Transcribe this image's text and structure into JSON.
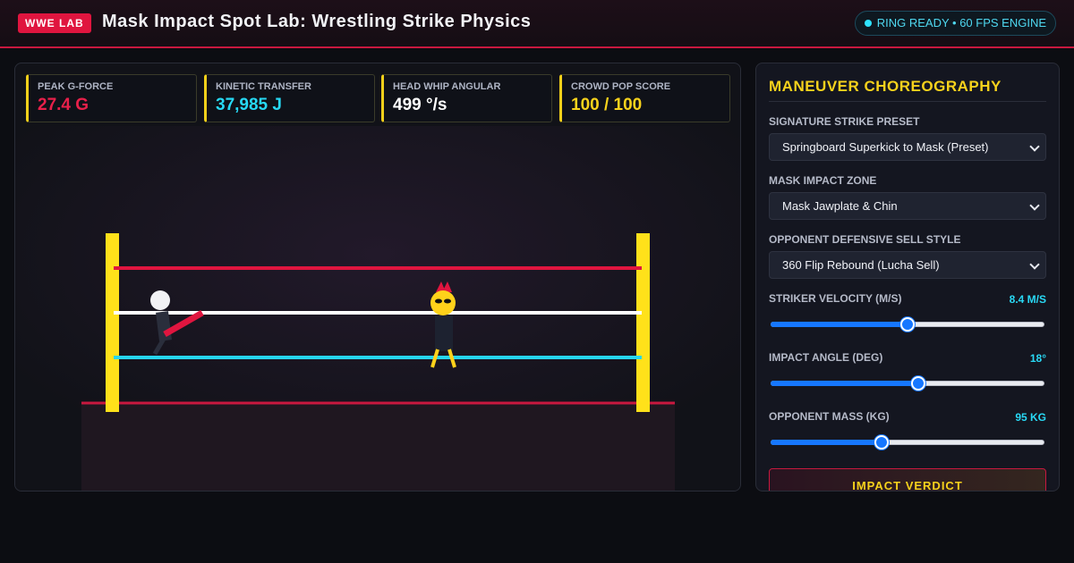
{
  "header": {
    "logo": "WWE LAB",
    "title": "Mask Impact Spot Lab: Wrestling Strike Physics",
    "status": "RING READY • 60 FPS ENGINE"
  },
  "metrics": [
    {
      "label": "PEAK G-FORCE",
      "value": "27.4 G",
      "color": "#e8204a"
    },
    {
      "label": "KINETIC TRANSFER",
      "value": "37,985 J",
      "color": "#27d9f5"
    },
    {
      "label": "HEAD WHIP ANGULAR",
      "value": "499 °/s",
      "color": "#ffffff"
    },
    {
      "label": "CROWD POP SCORE",
      "value": "100 / 100",
      "color": "#f7d21c"
    }
  ],
  "ring": {
    "post_color": "#ffe11a",
    "rope_colors": [
      "#e0153f",
      "#ffffff",
      "#26d6f0"
    ],
    "apron_line_color": "#c8183f"
  },
  "panel": {
    "title": "MANEUVER CHOREOGRAPHY",
    "selects": [
      {
        "label": "SIGNATURE STRIKE PRESET",
        "value": "Springboard Superkick to Mask (Preset)"
      },
      {
        "label": "MASK IMPACT ZONE",
        "value": "Mask Jawplate & Chin"
      },
      {
        "label": "OPPONENT DEFENSIVE SELL STYLE",
        "value": "360 Flip Rebound (Lucha Sell)"
      }
    ],
    "sliders": [
      {
        "label": "STRIKER VELOCITY (M/S)",
        "value": "8.4 M/S",
        "fraction": 0.5
      },
      {
        "label": "IMPACT ANGLE (DEG)",
        "value": "18°",
        "fraction": 0.54
      },
      {
        "label": "OPPONENT MASS (KG)",
        "value": "95 KG",
        "fraction": 0.4
      }
    ],
    "verdict_title": "IMPACT VERDICT"
  }
}
